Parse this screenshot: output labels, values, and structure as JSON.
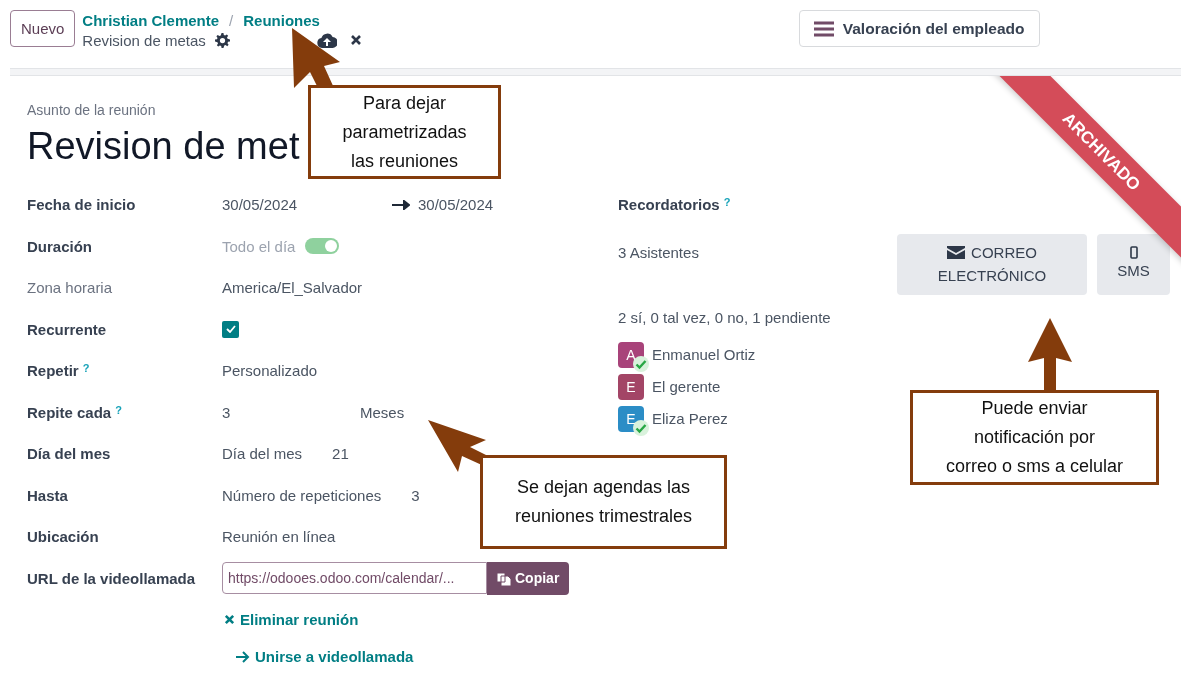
{
  "topbar": {
    "new_button": "Nuevo",
    "breadcrumbs": [
      "Christian Clemente",
      "Reuniones"
    ],
    "separator": "/",
    "record_name": "Revision de metas",
    "action_button": "Valoración del empleado"
  },
  "form": {
    "subtitle": "Asunto de la reunión",
    "title": "Revision de met",
    "ribbon": "ARCHIVADO",
    "rows": [
      {
        "kind": "daterange",
        "label": "Fecha de inicio",
        "start": "30/05/2024",
        "end": "30/05/2024"
      },
      {
        "kind": "toggle",
        "label": "Duración",
        "text": "Todo el día",
        "on": true
      },
      {
        "kind": "text",
        "label": "Zona horaria",
        "label_muted": true,
        "value": "America/El_Salvador"
      },
      {
        "kind": "checkbox",
        "label": "Recurrente",
        "checked": true
      },
      {
        "kind": "text",
        "label": "Repetir",
        "help": "?",
        "value": "Personalizado"
      },
      {
        "kind": "interval",
        "label": "Repite cada",
        "help": "?",
        "value": "3",
        "unit": "Meses"
      },
      {
        "kind": "inline",
        "label": "Día del mes",
        "parts": [
          "Día del mes",
          "21"
        ]
      },
      {
        "kind": "inline",
        "label": "Hasta",
        "parts": [
          "Número de repeticiones",
          "3"
        ]
      },
      {
        "kind": "text",
        "label": "Ubicación",
        "value": "Reunión en línea"
      },
      {
        "kind": "url",
        "label": "URL de la videollamada",
        "value": "https://odooes.odoo.com/calendar/...",
        "button": "Copiar"
      }
    ],
    "links": [
      {
        "kind": "remove",
        "text": "Eliminar reunión"
      },
      {
        "kind": "join",
        "text": "Unirse a videollamada"
      }
    ],
    "reminders": {
      "label": "Recordatorios",
      "help": "?"
    },
    "attendees_count": "3 Asistentes",
    "send_buttons": [
      {
        "kind": "email",
        "label": "CORREO ELECTRÓNICO"
      },
      {
        "kind": "sms",
        "label": "SMS"
      }
    ],
    "summary": "2 sí, 0 tal vez, 0 no, 1 pendiente",
    "attendees": [
      {
        "initial": "A",
        "name": "Enmanuel Ortiz",
        "color": "#a8437a",
        "accepted": true
      },
      {
        "initial": "E",
        "name": "El gerente",
        "color": "#a34566",
        "accepted": false
      },
      {
        "initial": "E",
        "name": "Eliza Perez",
        "color": "#2b8dc6",
        "accepted": true
      }
    ]
  },
  "callouts": [
    {
      "lines": [
        "Para dejar",
        "parametrizadas",
        "las reuniones"
      ]
    },
    {
      "lines": [
        "Se dejan agendas las",
        "reuniones trimestrales"
      ]
    },
    {
      "lines": [
        "Puede enviar",
        "notificación por",
        "correo o sms a celular"
      ]
    }
  ]
}
